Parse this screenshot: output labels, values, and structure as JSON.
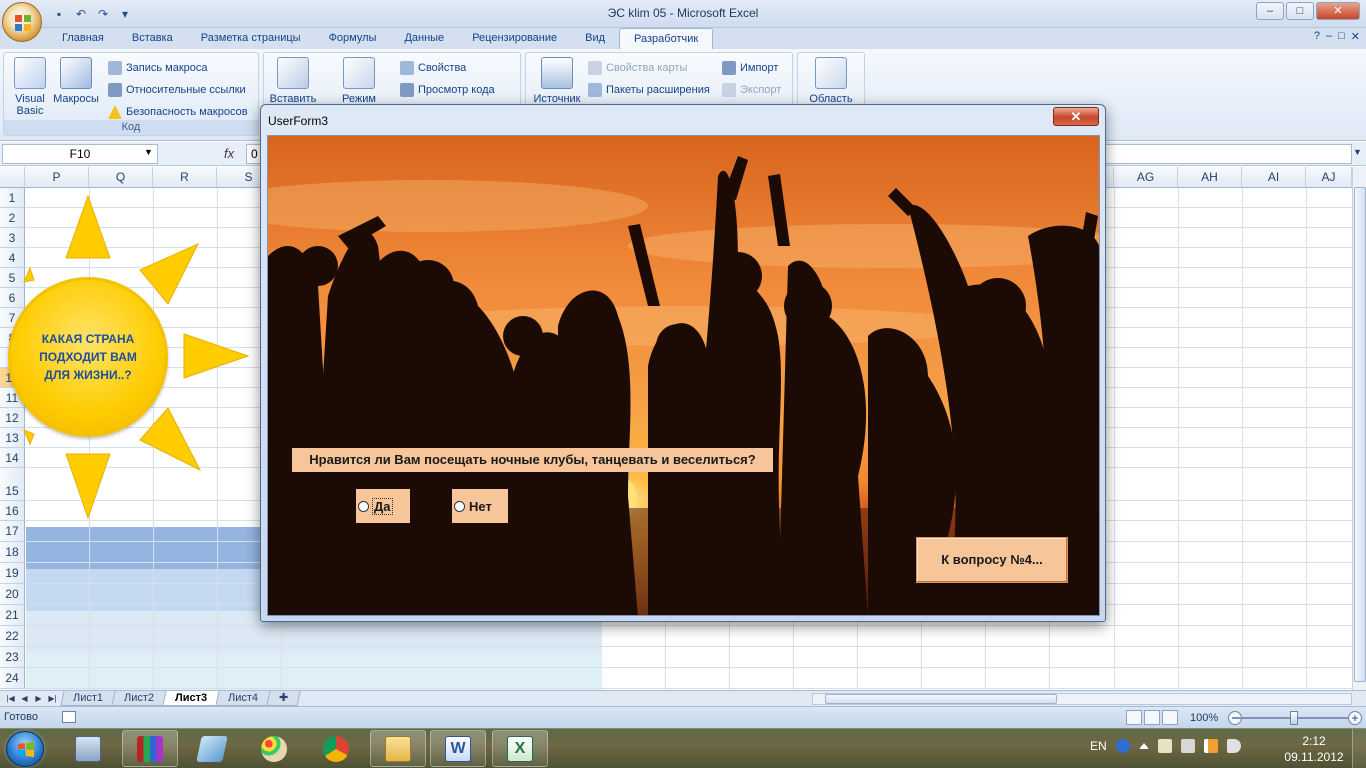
{
  "window": {
    "title": "ЭС klim 05  -  Microsoft Excel",
    "controls": [
      "–",
      "□",
      "✕"
    ]
  },
  "ribbon": {
    "tabs": [
      "Главная",
      "Вставка",
      "Разметка страницы",
      "Формулы",
      "Данные",
      "Рецензирование",
      "Вид",
      "Разработчик"
    ],
    "active_tab": "Разработчик",
    "help": "?",
    "code_group": {
      "label": "Код",
      "visual_basic_line1": "Visual",
      "visual_basic_line2": "Basic",
      "macros": "Макросы",
      "record_macro": "Запись макроса",
      "relative_refs": "Относительные ссылки",
      "macro_security": "Безопасность макросов"
    },
    "controls_group": {
      "insert": "Вставить",
      "mode": "Режим",
      "properties": "Свойства",
      "view_code": "Просмотр кода"
    },
    "xml_group": {
      "source": "Источник",
      "map_properties": "Свойства карты",
      "expansion_packs": "Пакеты расширения",
      "import": "Импорт",
      "export": "Экспорт"
    },
    "modify_group": {
      "document_panel": "Область"
    }
  },
  "formula_bar": {
    "name_box": "F10",
    "fx": "fx",
    "value": "0"
  },
  "grid": {
    "left_columns": [
      "P",
      "Q",
      "R",
      "S"
    ],
    "right_columns": [
      "AG",
      "AH",
      "AI",
      "AJ"
    ],
    "rows": [
      "1",
      "2",
      "3",
      "4",
      "5",
      "6",
      "7",
      "8",
      "9",
      "10",
      "11",
      "12",
      "13",
      "14",
      "15",
      "16",
      "17",
      "18",
      "19",
      "20",
      "21",
      "22",
      "23",
      "24"
    ],
    "selected_row": "10",
    "shape_text": "КАКАЯ СТРАНА ПОДХОДИТ ВАМ ДЛЯ ЖИЗНИ..?"
  },
  "sheets": {
    "tabs": [
      "Лист1",
      "Лист2",
      "Лист3",
      "Лист4"
    ],
    "active": "Лист3"
  },
  "status_bar": {
    "ready": "Готово",
    "zoom": "100%"
  },
  "dialog": {
    "title": "UserForm3",
    "close": "✕",
    "question": "Нравится ли Вам посещать ночные клубы, танцевать и веселиться?",
    "option_yes": "Да",
    "option_no": "Нет",
    "next_button": "К вопросу №4..."
  },
  "taskbar": {
    "lang": "EN",
    "time": "2:12",
    "date": "09.11.2012"
  },
  "colors": {
    "form_label_bg": "#f7c59a",
    "sun_yellow": "#ffcc00",
    "sun_text": "#1f4e9c",
    "row_band_1": "#95b4e0",
    "row_band_2": "#c5d8f1",
    "row_band_3": "#dde8f5",
    "row_band_4": "#dfeff6"
  }
}
